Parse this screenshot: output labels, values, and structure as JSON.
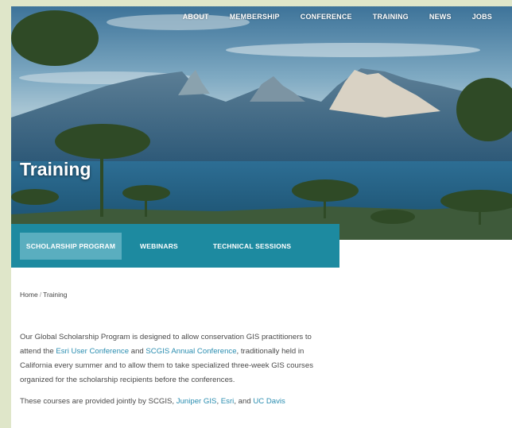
{
  "nav": {
    "items": [
      "ABOUT",
      "MEMBERSHIP",
      "CONFERENCE",
      "TRAINING",
      "NEWS",
      "JOBS"
    ]
  },
  "hero": {
    "title": "Training"
  },
  "tabs": [
    {
      "label": "SCHOLARSHIP PROGRAM",
      "active": true
    },
    {
      "label": "WEBINARS",
      "active": false
    },
    {
      "label": "TECHNICAL SESSIONS",
      "active": false
    }
  ],
  "breadcrumb": {
    "home": "Home",
    "separator": "/",
    "current": "Training"
  },
  "content": {
    "p1_a": "Our Global Scholarship Program is designed to allow conservation GIS practitioners to attend the ",
    "p1_link1": "Esri User Conference",
    "p1_b": " and ",
    "p1_link2": "SCGIS Annual Conference",
    "p1_c": ", traditionally held in California every summer and to allow them to take specialized three-week GIS courses organized for the scholarship recipients before the conferences.",
    "p2_a": "These courses are provided jointly by SCGIS, ",
    "p2_link1": "Juniper GIS",
    "p2_b": ", ",
    "p2_link2": "Esri",
    "p2_c": ", and ",
    "p2_link3": "UC Davis"
  },
  "colors": {
    "tab_bar": "#1d8aa0",
    "tab_active": "#5aaebf",
    "link": "#2a8db0",
    "page_bg": "#dfe6c9"
  }
}
